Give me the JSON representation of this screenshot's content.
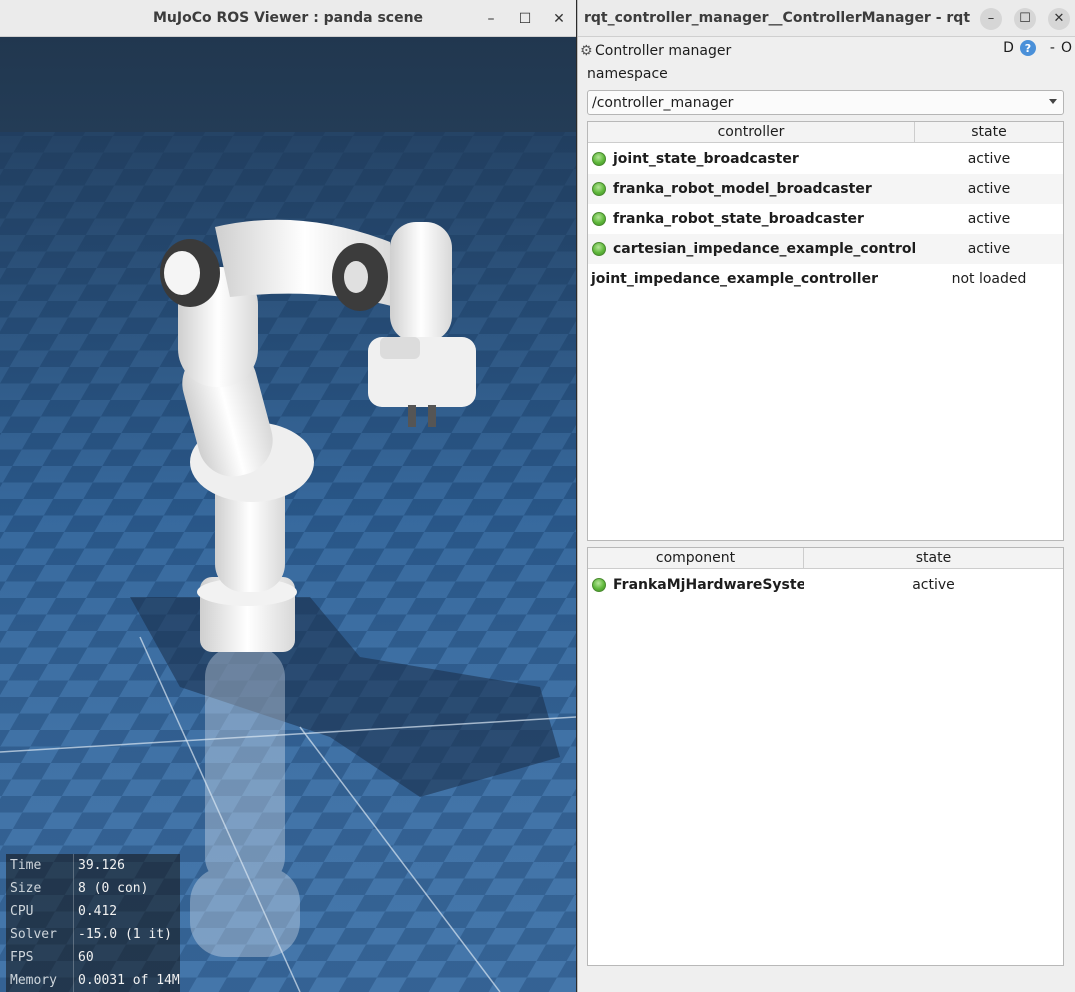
{
  "viewer": {
    "title": "MuJoCo ROS Viewer : panda scene",
    "controls": {
      "minimize": "–",
      "maximize": "☐",
      "close": "✕"
    },
    "stats": [
      {
        "label": "Time",
        "value": "39.126"
      },
      {
        "label": "Size",
        "value": "8 (0 con)"
      },
      {
        "label": "CPU",
        "value": "0.412"
      },
      {
        "label": "Solver",
        "value": "-15.0 (1 it)"
      },
      {
        "label": "FPS",
        "value": "60"
      },
      {
        "label": "Memory",
        "value": "0.0031 of 14M"
      }
    ]
  },
  "rqt": {
    "title": "rqt_controller_manager__ControllerManager - rqt",
    "controls": {
      "minimize": "–",
      "maximize": "☐",
      "close": "✕"
    },
    "plugin_title": "Controller manager",
    "plugin_right": {
      "d_label": "D",
      "help": "?",
      "dash": "-",
      "o_label": "O"
    },
    "namespace_label": "namespace",
    "namespace_value": "/controller_manager",
    "controllers": {
      "headers": {
        "name": "controller",
        "state": "state"
      },
      "rows": [
        {
          "name": "joint_state_broadcaster",
          "state": "active",
          "led": true
        },
        {
          "name": "franka_robot_model_broadcaster",
          "state": "active",
          "led": true
        },
        {
          "name": "franka_robot_state_broadcaster",
          "state": "active",
          "led": true
        },
        {
          "name": "cartesian_impedance_example_controller",
          "state": "active",
          "led": true
        },
        {
          "name": "joint_impedance_example_controller",
          "state": "not loaded",
          "led": false
        }
      ]
    },
    "components": {
      "headers": {
        "name": "component",
        "state": "state"
      },
      "rows": [
        {
          "name": "FrankaMjHardwareSystem",
          "state": "active",
          "led": true
        }
      ]
    }
  },
  "colors": {
    "led_active": "#5fb83b",
    "sky_top": "#2a4a6c",
    "floor_light": "#6f9fd0",
    "floor_dark": "#2d5f95"
  },
  "icons": {
    "gear": "gear-icon",
    "help": "help-icon",
    "led": "status-led-icon"
  }
}
